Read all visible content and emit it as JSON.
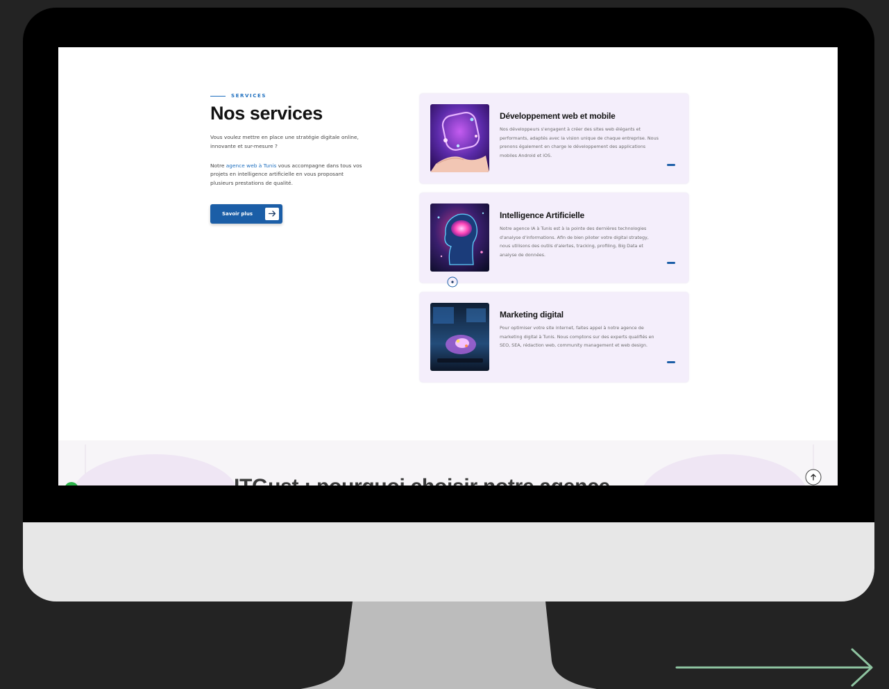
{
  "services": {
    "eyebrow": "SERVICES",
    "title": "Nos services",
    "intro_1": "Vous voulez mettre en place une stratégie digitale online, innovante et sur-mesure ?",
    "intro_2_before": "Notre ",
    "intro_2_link": "agence web à Tunis",
    "intro_2_after": " vous accompagne dans tous vos projets en intelligence artificielle en vous proposant plusieurs prestations de qualité.",
    "cta_label": "Savoir plus",
    "cta_icon": "arrow-right-icon"
  },
  "cards": [
    {
      "title": "Développement web et mobile",
      "description": "Nos développeurs s'engagent à créer des sites web élégants et performants, adaptés avec la vision unique de chaque entreprise. Nous prenons également en charge le développement des applications mobiles Android et iOS.",
      "image_icon": "hand-hologram-image"
    },
    {
      "title": "Intelligence Artificielle",
      "description": "Notre agence IA à Tunis est à la pointe des dernières technologies d'analyse d'informations. Afin de bien piloter votre digital strategy, nous utilisons des outils d'alertes, tracking, profiling, Big Data et analyse de données.",
      "image_icon": "ai-head-image"
    },
    {
      "title": "Marketing digital",
      "description": "Pour optimiser votre site internet, faites appel à notre agence de marketing digital à Tunis. Nous comptons sur des experts qualifiés en SEO, SEA, rédaction web, community management et web design.",
      "image_icon": "marketing-image"
    }
  ],
  "next_section": {
    "title": "ITGust : pourquoi choisir notre agence"
  },
  "colors": {
    "accent": "#1b5ea7",
    "card_bg": "#f4eefb",
    "next_arrow": "#8ec3a0"
  }
}
